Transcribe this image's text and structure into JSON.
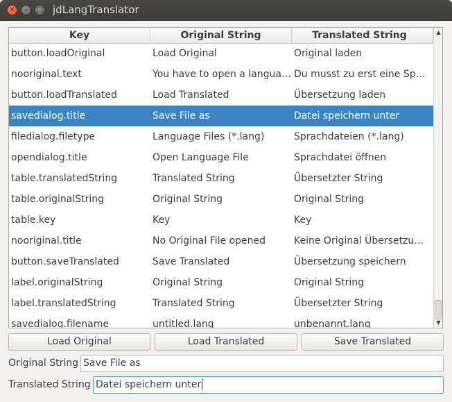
{
  "window": {
    "title": "jdLangTranslator"
  },
  "table": {
    "headers": [
      "Key",
      "Original String",
      "Translated String"
    ],
    "rows": [
      [
        "button.loadOriginal",
        "Load Original",
        "Original laden"
      ],
      [
        "nooriginal.text",
        "You have to open a language file first",
        "Du musst zu erst eine Sprachdatei öffnen"
      ],
      [
        "button.loadTranslated",
        "Load Translated",
        "Übersetzung laden"
      ],
      [
        "savedialog.title",
        "Save File as",
        "Datei speichern unter"
      ],
      [
        "filedialog.filetype",
        "Language Files (*.lang)",
        "Sprachdateien (*.lang)"
      ],
      [
        "opendialog.title",
        "Open Language File",
        "Sprachdatei öffnen"
      ],
      [
        "table.translatedString",
        "Translated String",
        "Übersetzter String"
      ],
      [
        "table.originalString",
        "Original String",
        "Original String"
      ],
      [
        "table.key",
        "Key",
        "Key"
      ],
      [
        "nooriginal.title",
        "No Original File opened",
        "Keine Original Übersetzung geöffnet"
      ],
      [
        "button.saveTranslated",
        "Save Translated",
        "Übersetzung speichern"
      ],
      [
        "label.originalString",
        "Original String",
        "Original String"
      ],
      [
        "label.translatedString",
        "Translated String",
        "Übersetzter String"
      ],
      [
        "savedialog.filename",
        "untitled.lang",
        "unbenannt.lang"
      ]
    ],
    "selected_row": 3
  },
  "buttons": {
    "load_original": "Load Original",
    "load_translated": "Load Translated",
    "save_translated": "Save Translated"
  },
  "form": {
    "original_label": "Original String",
    "original_value": "Save File as",
    "translated_label": "Translated String",
    "translated_value": "Datei speichern unter"
  },
  "icons": {
    "close": "close-icon",
    "minimize": "minimize-icon",
    "maximize": "maximize-icon"
  },
  "colors": {
    "selection": "#3b84c4",
    "titlebar": "#3c3b37",
    "close_button": "#e0541f"
  }
}
